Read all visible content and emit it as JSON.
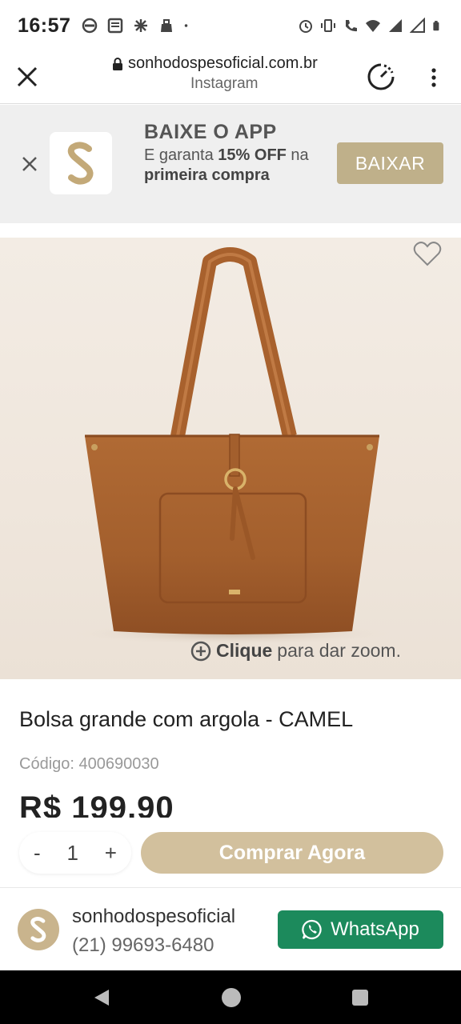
{
  "status_bar": {
    "time": "16:57",
    "left_icons": [
      "sync-icon",
      "news-icon",
      "fan-icon",
      "bag-icon",
      "dot-icon"
    ],
    "right_icons": [
      "alarm-icon",
      "vibrate-icon",
      "wifi-call-icon",
      "wifi-icon",
      "signal-5g-icon",
      "signal-icon",
      "battery-icon"
    ]
  },
  "browser": {
    "url": "sonhodospesoficial.com.br",
    "source": "Instagram"
  },
  "app_banner": {
    "title": "BAIXE O APP",
    "desc_part1": "E garanta ",
    "desc_bold1": "15% OFF",
    "desc_part2": " na ",
    "desc_bold2": "primeira",
    "desc_part3": " compra",
    "button_label": "BAIXAR",
    "accent_color": "#bfb08a"
  },
  "product": {
    "zoom_bold": "Clique",
    "zoom_text": "para dar zoom.",
    "title": "Bolsa grande com argola - CAMEL",
    "code_label": "Código: 400690030",
    "price": "R$ 199,90",
    "image_subject": "camel leather tote bag"
  },
  "buy_row": {
    "minus_label": "-",
    "quantity": "1",
    "plus_label": "+",
    "buy_label": "Comprar Agora",
    "buy_color": "#d2c09d"
  },
  "seller": {
    "name": "sonhodospesoficial",
    "phone": "(21) 99693-6480",
    "whatsapp_label": "WhatsApp",
    "whatsapp_color": "#1c8a5c"
  }
}
